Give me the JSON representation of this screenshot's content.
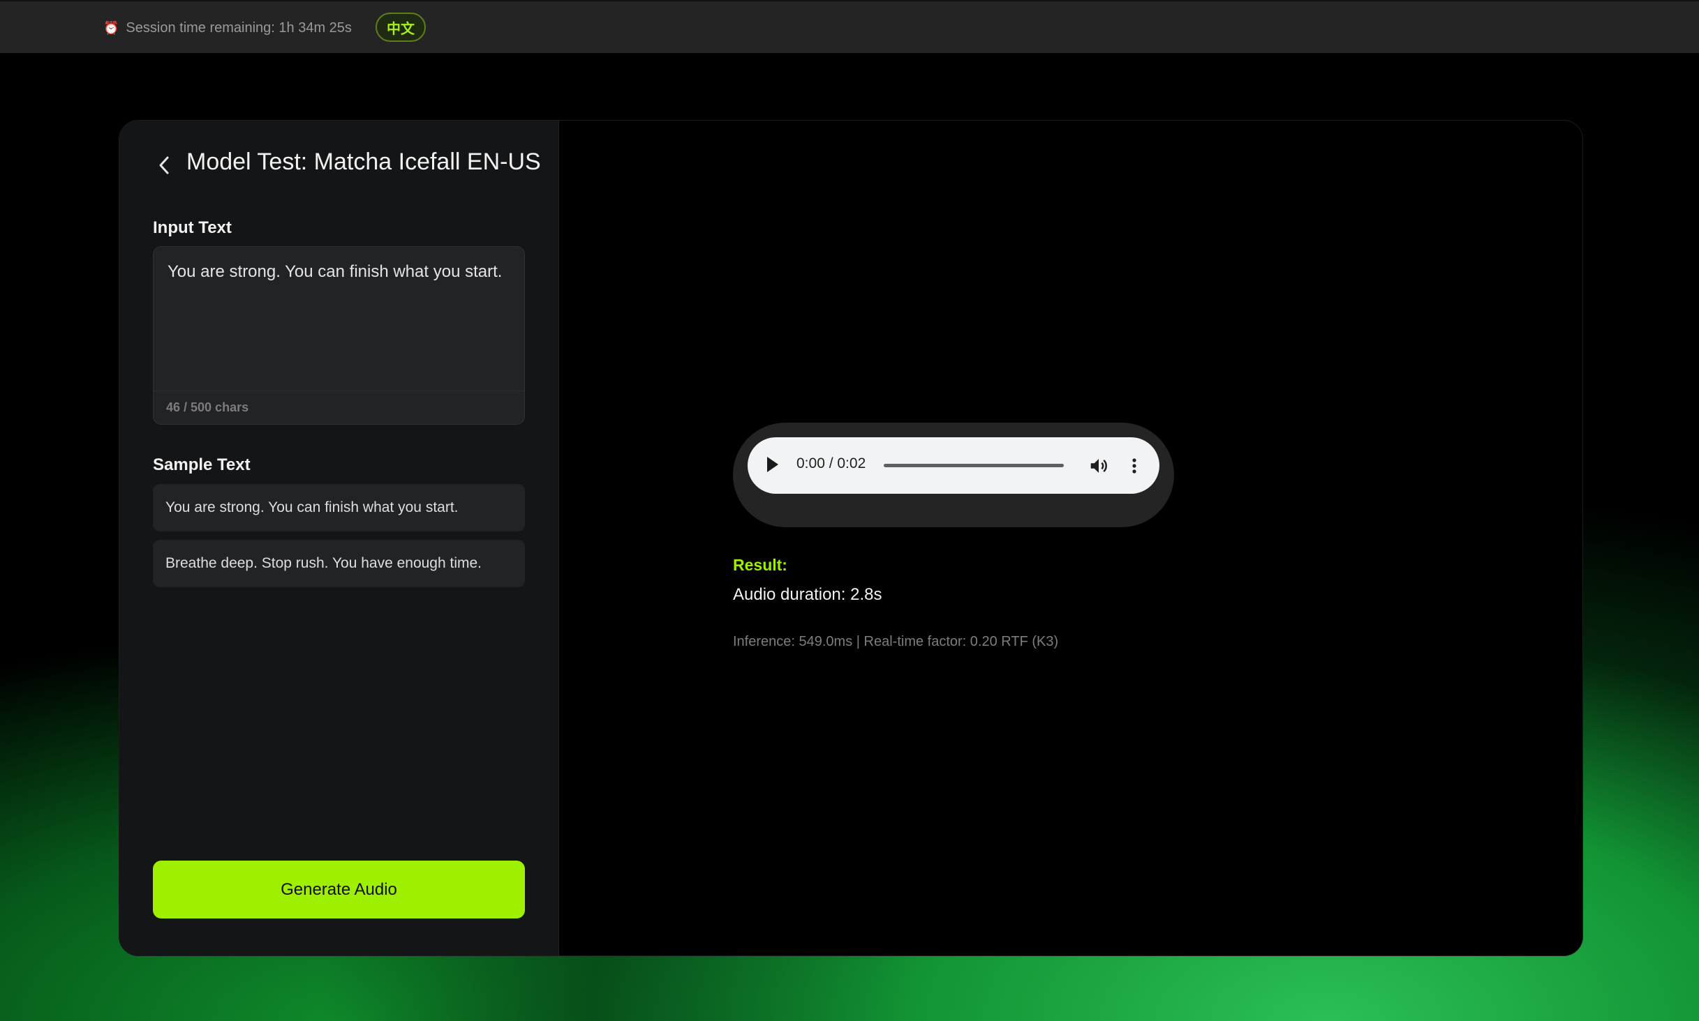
{
  "topbar": {
    "clock_icon": "alarm-clock-icon",
    "session_text": "Session time remaining: 1h 34m 25s",
    "language_button": "中文"
  },
  "panel": {
    "title": "Model Test: Matcha Icefall EN-US",
    "input_label": "Input Text",
    "input_value": "You are strong. You can finish what you start.",
    "char_count": "46 / 500 chars",
    "sample_label": "Sample Text",
    "samples": [
      "You are strong. You can finish what you start.",
      "Breathe deep. Stop rush. You have enough time."
    ],
    "generate_label": "Generate Audio"
  },
  "player": {
    "time": "0:00 / 0:02",
    "progress": 0
  },
  "result": {
    "label": "Result:",
    "duration": "Audio duration: 2.8s",
    "inference": "Inference: 549.0ms | Real-time factor: 0.20 RTF (K3)"
  },
  "colors": {
    "accent": "#9ef000",
    "panel_bg": "#141517",
    "field_bg": "#222326"
  }
}
